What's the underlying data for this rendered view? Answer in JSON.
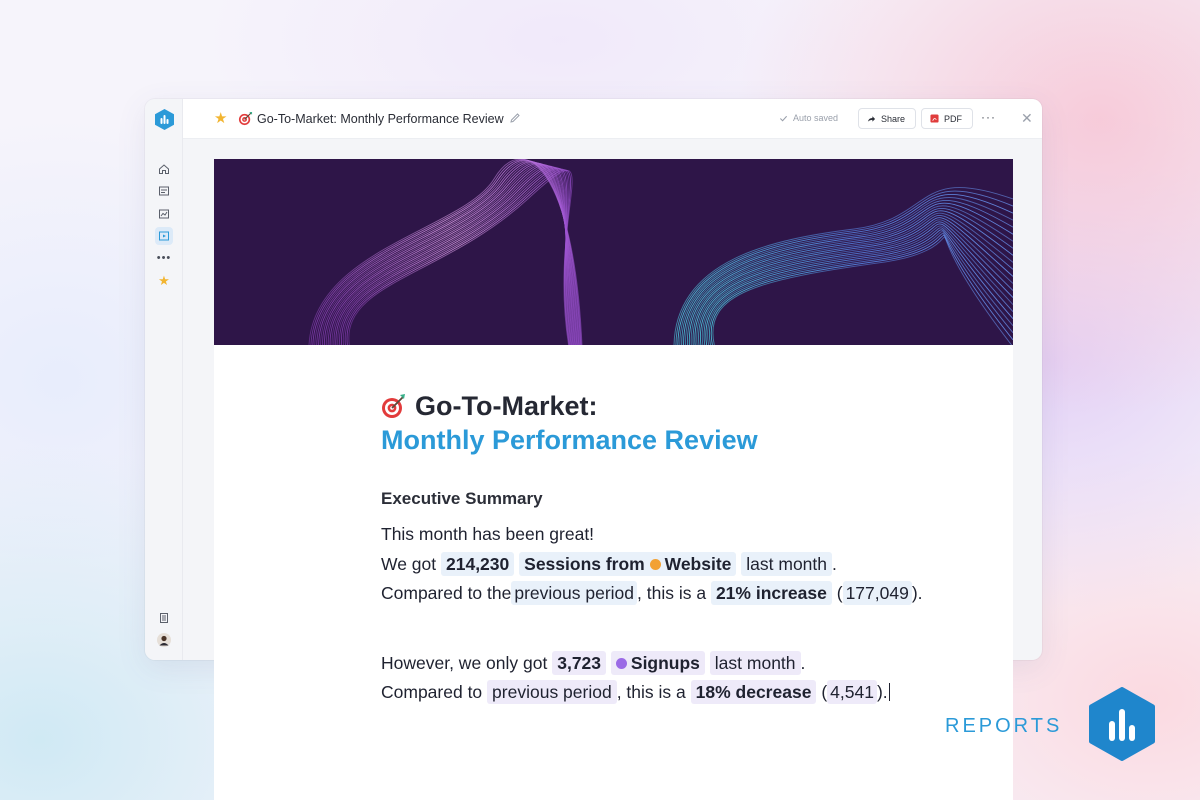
{
  "colors": {
    "accent": "#2b9ad8",
    "star": "#f2b531",
    "chip_blue": "#e9f1fa",
    "chip_purple": "#eeeaf9",
    "banner_bg": "#2e1548"
  },
  "topbar": {
    "title": "Go-To-Market: Monthly Performance Review",
    "autosave": "Auto saved",
    "share_label": "Share",
    "pdf_label": "PDF",
    "more_label": "···",
    "close_label": "✕"
  },
  "sidebar": {
    "items": [
      {
        "icon": "home-icon"
      },
      {
        "icon": "dashboard-icon"
      },
      {
        "icon": "metrics-icon"
      },
      {
        "icon": "reports-icon",
        "active": true
      },
      {
        "icon": "more-icon"
      },
      {
        "icon": "star-icon"
      }
    ],
    "bottom": [
      {
        "icon": "docs-icon"
      },
      {
        "icon": "avatar"
      }
    ]
  },
  "document": {
    "title": "Go-To-Market:",
    "subtitle": "Monthly Performance Review",
    "section_heading": "Executive Summary",
    "line1": "This month has been great!",
    "sessions": {
      "prefix": "We got",
      "value": "214,230",
      "metric": "Sessions from",
      "source": "Website",
      "period": "last month",
      "suffix": "."
    },
    "sessions_compare": {
      "prefix": "Compared to the",
      "period": "previous period",
      "mid": ", this is a",
      "change": "21% increase",
      "open": "(",
      "previous_value": "177,049",
      "close": ")."
    },
    "signups": {
      "prefix": "However, we only got",
      "value": "3,723",
      "metric": "Signups",
      "period": "last month",
      "suffix": "."
    },
    "signups_compare": {
      "prefix": "Compared to",
      "period": "previous period",
      "mid": ", this is a",
      "change": "18% decrease",
      "open": "(",
      "previous_value": "4,541",
      "close": ")."
    }
  },
  "brand": {
    "label": "REPORTS"
  }
}
